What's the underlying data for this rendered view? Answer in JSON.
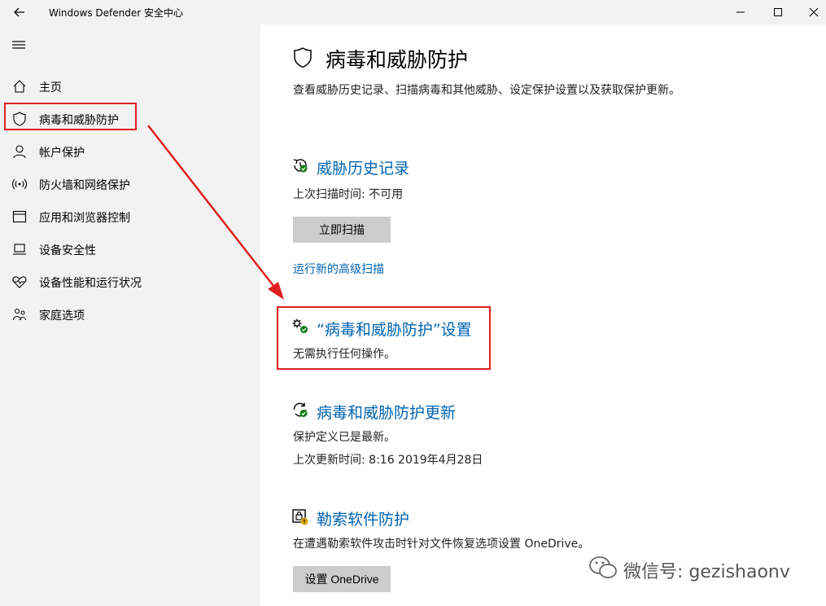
{
  "titlebar": {
    "title": "Windows Defender 安全中心"
  },
  "sidebar": {
    "items": [
      {
        "label": "主页",
        "icon": "home-icon"
      },
      {
        "label": "病毒和威胁防护",
        "icon": "shield-icon",
        "active": true
      },
      {
        "label": "帐户保护",
        "icon": "person-icon"
      },
      {
        "label": "防火墙和网络保护",
        "icon": "wifi-icon"
      },
      {
        "label": "应用和浏览器控制",
        "icon": "app-window-icon"
      },
      {
        "label": "设备安全性",
        "icon": "laptop-icon"
      },
      {
        "label": "设备性能和运行状况",
        "icon": "heart-icon"
      },
      {
        "label": "家庭选项",
        "icon": "family-icon"
      }
    ]
  },
  "main": {
    "title": "病毒和威胁防护",
    "description": "查看威胁历史记录、扫描病毒和其他威胁、设定保护设置以及获取保护更新。",
    "history": {
      "title": "威胁历史记录",
      "last_scan": "上次扫描时间: 不可用",
      "scan_button": "立即扫描",
      "advanced_link": "运行新的高级扫描"
    },
    "settings": {
      "title": "“病毒和威胁防护”设置",
      "status": "无需执行任何操作。"
    },
    "updates": {
      "title": "病毒和威胁防护更新",
      "status": "保护定义已是最新。",
      "last_update": "上次更新时间: 8:16 2019年4月28日"
    },
    "ransomware": {
      "title": "勒索软件防护",
      "description": "在遭遇勒索软件攻击时针对文件恢复选项设置 OneDrive。",
      "button": "设置 OneDrive"
    }
  },
  "watermark": {
    "text": "微信号: gezishaonv"
  },
  "colors": {
    "link": "#0063b1",
    "sidebar_bg": "#f2f2f2",
    "annotation": "#e02020",
    "button_bg": "#cccccc"
  }
}
